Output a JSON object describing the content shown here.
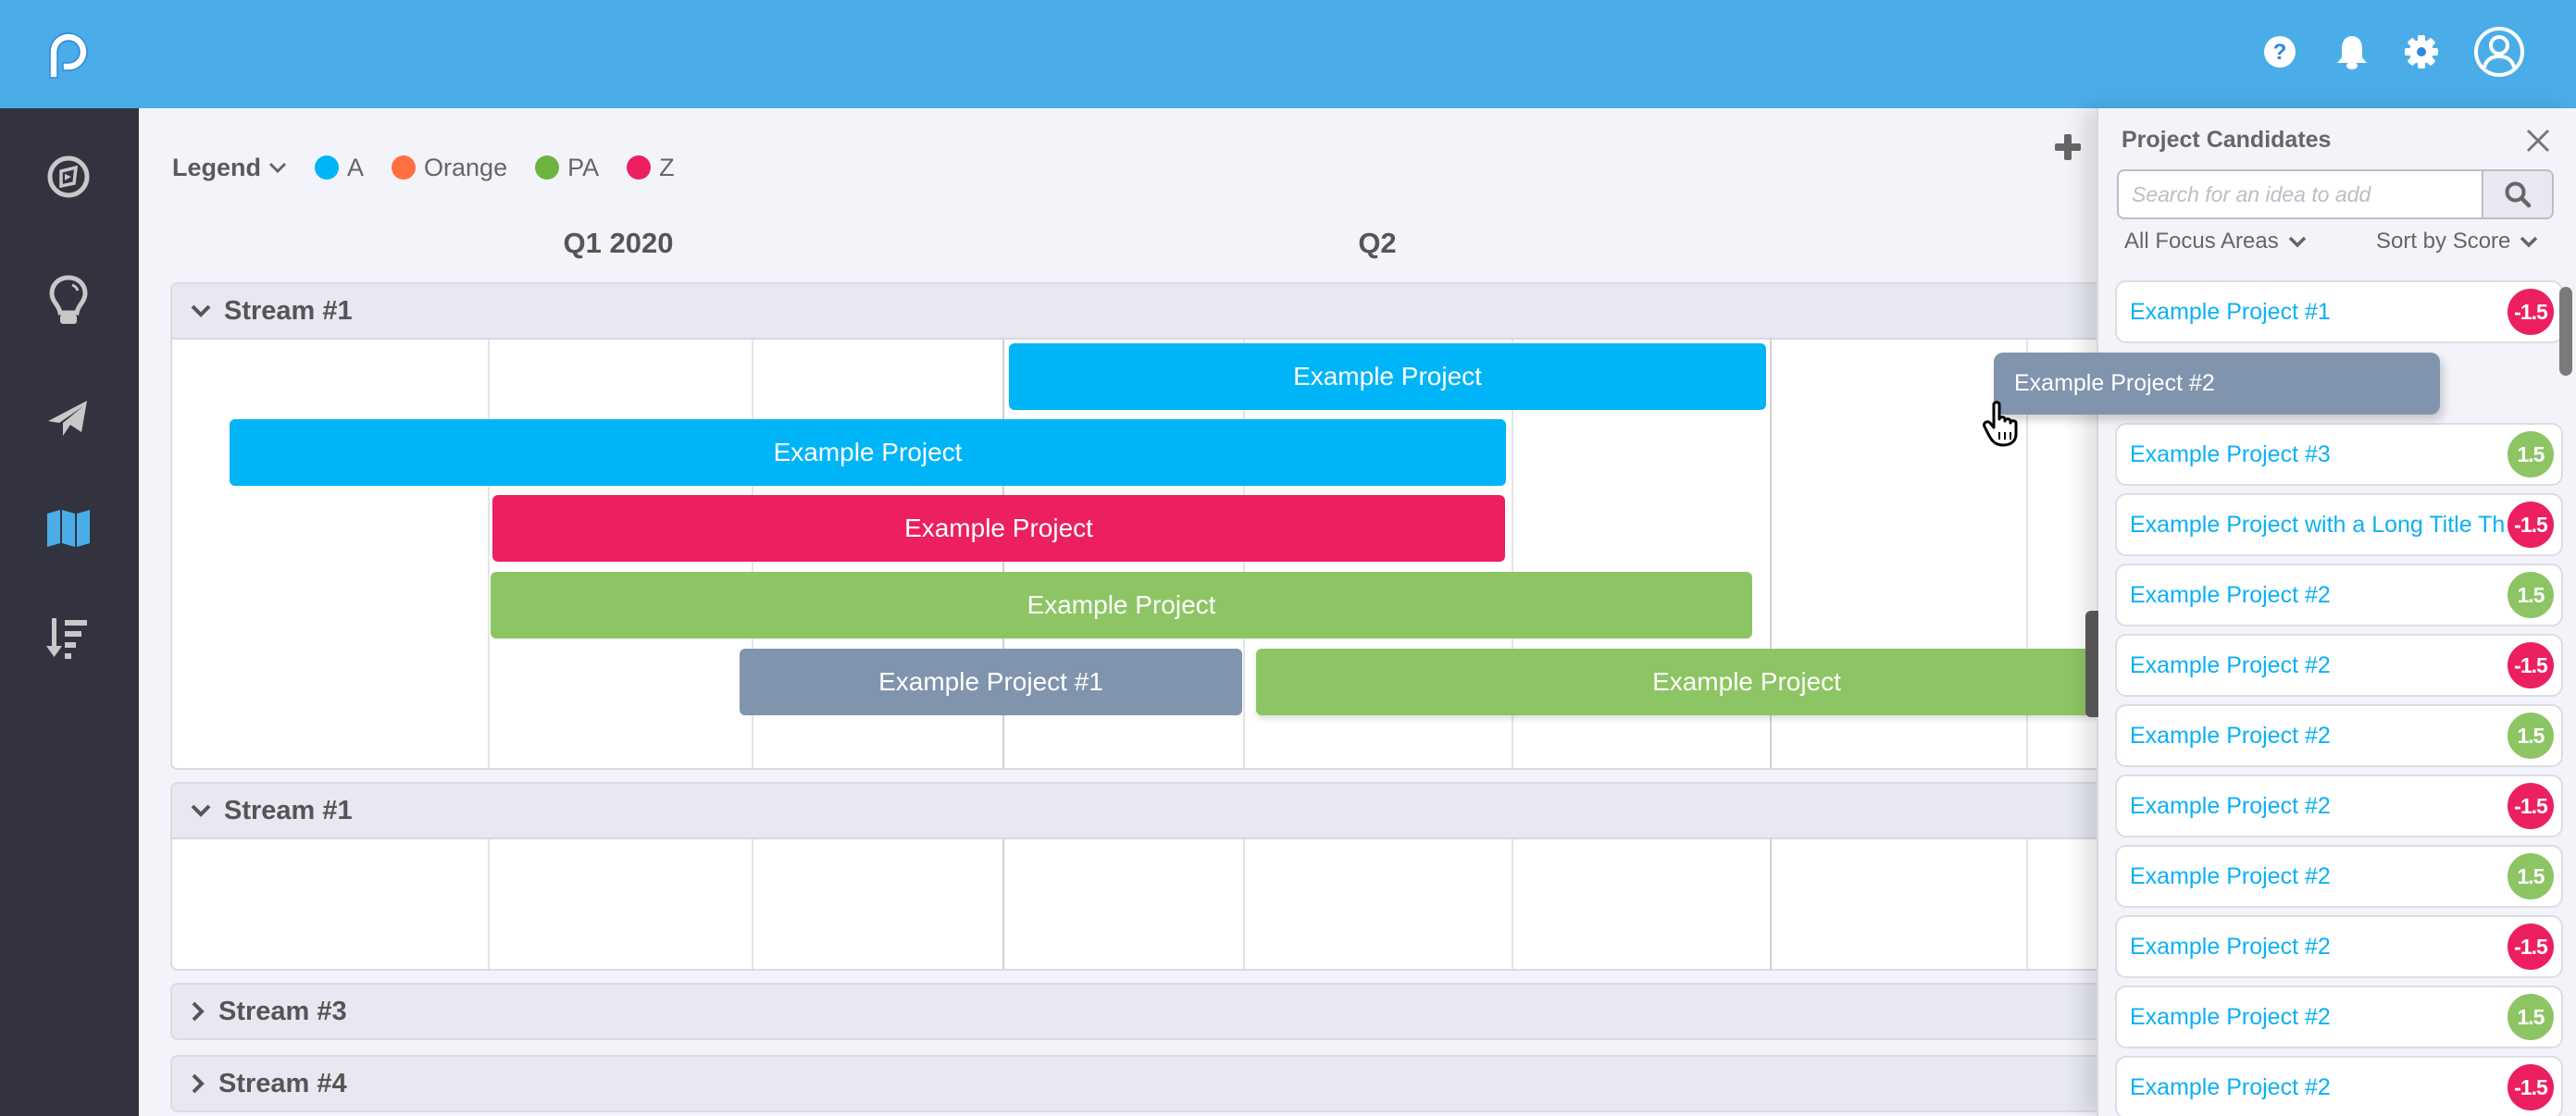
{
  "header": {
    "logo": "logo-p",
    "icons": [
      {
        "name": "help-icon",
        "label": "Help"
      },
      {
        "name": "bell-icon",
        "label": "Notifications"
      },
      {
        "name": "gear-icon",
        "label": "Settings"
      },
      {
        "name": "user-avatar-icon",
        "label": "Profile"
      }
    ]
  },
  "sidebar": {
    "items": [
      {
        "name": "compass-icon",
        "active": false
      },
      {
        "name": "lightbulb-icon",
        "active": false
      },
      {
        "name": "paper-plane-icon",
        "active": false
      },
      {
        "name": "map-icon",
        "active": true
      },
      {
        "name": "sort-descending-icon",
        "active": false
      }
    ]
  },
  "legend": {
    "title": "Legend",
    "items": [
      {
        "label": "A",
        "color": "#00B5F7"
      },
      {
        "label": "Orange",
        "color": "#FF6F42"
      },
      {
        "label": "PA",
        "color": "#6CB43F"
      },
      {
        "label": "Z",
        "color": "#EC1F61"
      }
    ]
  },
  "timeline": {
    "quarters": [
      "Q1 2020",
      "Q2"
    ],
    "streams": [
      {
        "name": "Stream #1",
        "expanded": true,
        "bars": [
          {
            "label": "Example Project",
            "color": "#00B5F7"
          },
          {
            "label": "Example Project",
            "color": "#00B5F7"
          },
          {
            "label": "Example Project",
            "color": "#EC1F61"
          },
          {
            "label": "Example Project",
            "color": "#8DC564"
          },
          {
            "label": "Example Project #1",
            "color": "#8094AE"
          },
          {
            "label": "Example Project",
            "color": "#8DC564"
          }
        ]
      },
      {
        "name": "Stream #1",
        "expanded": true,
        "bars": []
      },
      {
        "name": "Stream #3",
        "expanded": false
      },
      {
        "name": "Stream #4",
        "expanded": false
      }
    ]
  },
  "panel": {
    "title": "Project Candidates",
    "search_placeholder": "Search for an idea to add",
    "search_value": "",
    "focus_filter": "All Focus Areas",
    "sort": "Sort by Score",
    "colors": {
      "positive": "#8DC564",
      "negative": "#EC1F61"
    },
    "items": [
      {
        "title": "Example Project #1",
        "score": "-1.5"
      },
      {
        "title": "Example Project #3",
        "score": "1.5"
      },
      {
        "title": "Example Project with a Long Title Th..",
        "score": "-1.5"
      },
      {
        "title": "Example Project #2",
        "score": "1.5"
      },
      {
        "title": "Example Project #2",
        "score": "-1.5"
      },
      {
        "title": "Example Project #2",
        "score": "1.5"
      },
      {
        "title": "Example Project #2",
        "score": "-1.5"
      },
      {
        "title": "Example Project #2",
        "score": "1.5"
      },
      {
        "title": "Example Project #2",
        "score": "-1.5"
      },
      {
        "title": "Example Project #2",
        "score": "1.5"
      },
      {
        "title": "Example Project #2",
        "score": "-1.5"
      }
    ],
    "dragging_item": {
      "title": "Example Project #2"
    }
  }
}
